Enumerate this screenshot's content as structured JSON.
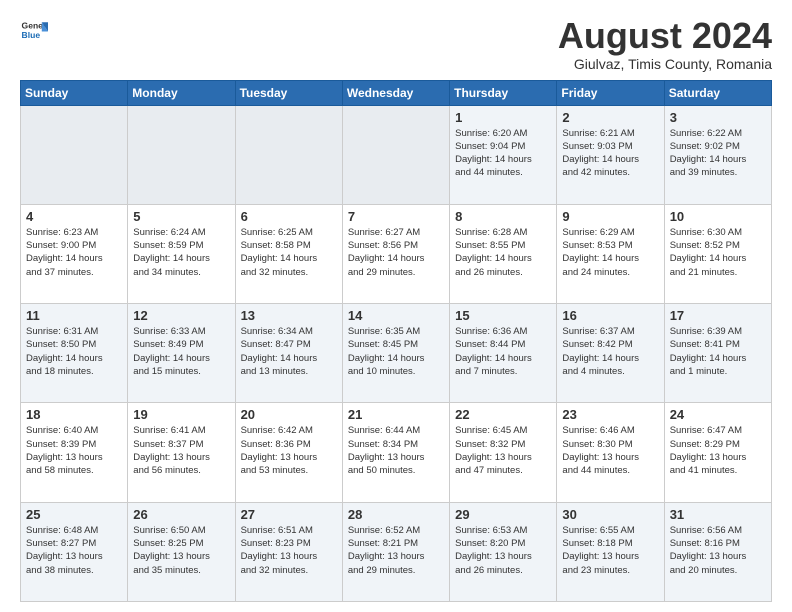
{
  "header": {
    "logo": {
      "general": "General",
      "blue": "Blue"
    },
    "title": "August 2024",
    "location": "Giulvaz, Timis County, Romania"
  },
  "weekdays": [
    "Sunday",
    "Monday",
    "Tuesday",
    "Wednesday",
    "Thursday",
    "Friday",
    "Saturday"
  ],
  "weeks": [
    [
      {
        "day": "",
        "info": ""
      },
      {
        "day": "",
        "info": ""
      },
      {
        "day": "",
        "info": ""
      },
      {
        "day": "",
        "info": ""
      },
      {
        "day": "1",
        "info": "Sunrise: 6:20 AM\nSunset: 9:04 PM\nDaylight: 14 hours\nand 44 minutes."
      },
      {
        "day": "2",
        "info": "Sunrise: 6:21 AM\nSunset: 9:03 PM\nDaylight: 14 hours\nand 42 minutes."
      },
      {
        "day": "3",
        "info": "Sunrise: 6:22 AM\nSunset: 9:02 PM\nDaylight: 14 hours\nand 39 minutes."
      }
    ],
    [
      {
        "day": "4",
        "info": "Sunrise: 6:23 AM\nSunset: 9:00 PM\nDaylight: 14 hours\nand 37 minutes."
      },
      {
        "day": "5",
        "info": "Sunrise: 6:24 AM\nSunset: 8:59 PM\nDaylight: 14 hours\nand 34 minutes."
      },
      {
        "day": "6",
        "info": "Sunrise: 6:25 AM\nSunset: 8:58 PM\nDaylight: 14 hours\nand 32 minutes."
      },
      {
        "day": "7",
        "info": "Sunrise: 6:27 AM\nSunset: 8:56 PM\nDaylight: 14 hours\nand 29 minutes."
      },
      {
        "day": "8",
        "info": "Sunrise: 6:28 AM\nSunset: 8:55 PM\nDaylight: 14 hours\nand 26 minutes."
      },
      {
        "day": "9",
        "info": "Sunrise: 6:29 AM\nSunset: 8:53 PM\nDaylight: 14 hours\nand 24 minutes."
      },
      {
        "day": "10",
        "info": "Sunrise: 6:30 AM\nSunset: 8:52 PM\nDaylight: 14 hours\nand 21 minutes."
      }
    ],
    [
      {
        "day": "11",
        "info": "Sunrise: 6:31 AM\nSunset: 8:50 PM\nDaylight: 14 hours\nand 18 minutes."
      },
      {
        "day": "12",
        "info": "Sunrise: 6:33 AM\nSunset: 8:49 PM\nDaylight: 14 hours\nand 15 minutes."
      },
      {
        "day": "13",
        "info": "Sunrise: 6:34 AM\nSunset: 8:47 PM\nDaylight: 14 hours\nand 13 minutes."
      },
      {
        "day": "14",
        "info": "Sunrise: 6:35 AM\nSunset: 8:45 PM\nDaylight: 14 hours\nand 10 minutes."
      },
      {
        "day": "15",
        "info": "Sunrise: 6:36 AM\nSunset: 8:44 PM\nDaylight: 14 hours\nand 7 minutes."
      },
      {
        "day": "16",
        "info": "Sunrise: 6:37 AM\nSunset: 8:42 PM\nDaylight: 14 hours\nand 4 minutes."
      },
      {
        "day": "17",
        "info": "Sunrise: 6:39 AM\nSunset: 8:41 PM\nDaylight: 14 hours\nand 1 minute."
      }
    ],
    [
      {
        "day": "18",
        "info": "Sunrise: 6:40 AM\nSunset: 8:39 PM\nDaylight: 13 hours\nand 58 minutes."
      },
      {
        "day": "19",
        "info": "Sunrise: 6:41 AM\nSunset: 8:37 PM\nDaylight: 13 hours\nand 56 minutes."
      },
      {
        "day": "20",
        "info": "Sunrise: 6:42 AM\nSunset: 8:36 PM\nDaylight: 13 hours\nand 53 minutes."
      },
      {
        "day": "21",
        "info": "Sunrise: 6:44 AM\nSunset: 8:34 PM\nDaylight: 13 hours\nand 50 minutes."
      },
      {
        "day": "22",
        "info": "Sunrise: 6:45 AM\nSunset: 8:32 PM\nDaylight: 13 hours\nand 47 minutes."
      },
      {
        "day": "23",
        "info": "Sunrise: 6:46 AM\nSunset: 8:30 PM\nDaylight: 13 hours\nand 44 minutes."
      },
      {
        "day": "24",
        "info": "Sunrise: 6:47 AM\nSunset: 8:29 PM\nDaylight: 13 hours\nand 41 minutes."
      }
    ],
    [
      {
        "day": "25",
        "info": "Sunrise: 6:48 AM\nSunset: 8:27 PM\nDaylight: 13 hours\nand 38 minutes."
      },
      {
        "day": "26",
        "info": "Sunrise: 6:50 AM\nSunset: 8:25 PM\nDaylight: 13 hours\nand 35 minutes."
      },
      {
        "day": "27",
        "info": "Sunrise: 6:51 AM\nSunset: 8:23 PM\nDaylight: 13 hours\nand 32 minutes."
      },
      {
        "day": "28",
        "info": "Sunrise: 6:52 AM\nSunset: 8:21 PM\nDaylight: 13 hours\nand 29 minutes."
      },
      {
        "day": "29",
        "info": "Sunrise: 6:53 AM\nSunset: 8:20 PM\nDaylight: 13 hours\nand 26 minutes."
      },
      {
        "day": "30",
        "info": "Sunrise: 6:55 AM\nSunset: 8:18 PM\nDaylight: 13 hours\nand 23 minutes."
      },
      {
        "day": "31",
        "info": "Sunrise: 6:56 AM\nSunset: 8:16 PM\nDaylight: 13 hours\nand 20 minutes."
      }
    ]
  ]
}
